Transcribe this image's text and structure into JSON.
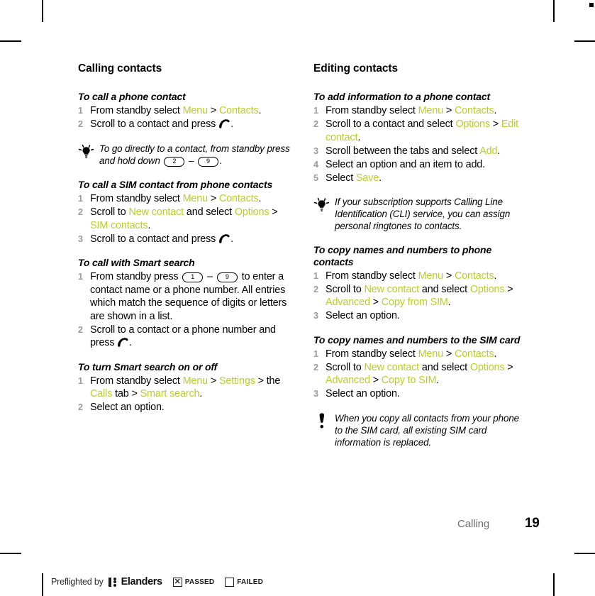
{
  "accent_color": "#b8cf28",
  "left_column": {
    "section_title": "Calling contacts",
    "blocks": [
      {
        "type": "procedure",
        "title": "To call a phone contact",
        "steps": [
          "From standby select <span class=\"g\">Menu</span> &gt; <span class=\"g\">Contacts</span>.",
          "Scroll to a contact and press <span class=\"callicon\" data-name=\"call-key-icon\"></span>."
        ]
      },
      {
        "type": "tip",
        "icon": "lightbulb-icon",
        "text": "To go directly to a contact, from standby press and hold down <span class=\"key\">2</span> &#8211; <span class=\"key\">9</span>."
      },
      {
        "type": "procedure",
        "title": "To call a SIM contact from phone contacts",
        "steps": [
          "From standby select <span class=\"g\">Menu</span> &gt; <span class=\"g\">Contacts</span>.",
          "Scroll to <span class=\"g\">New contact</span> and select <span class=\"g\">Options</span> &gt; <span class=\"g\">SIM contacts</span>.",
          "Scroll to a contact and press <span class=\"callicon\" data-name=\"call-key-icon\"></span>."
        ]
      },
      {
        "type": "procedure",
        "title": "To call with Smart search",
        "steps": [
          "From standby press <span class=\"key\">1</span> &#8211; <span class=\"key\">9</span> to enter a contact name or a phone number. All entries which match the sequence of digits or letters are shown in a list.",
          "Scroll to a contact or a phone number and press <span class=\"callicon\" data-name=\"call-key-icon\"></span>."
        ]
      },
      {
        "type": "procedure",
        "title": "To turn Smart search on or off",
        "steps": [
          "From standby select <span class=\"g\">Menu</span> &gt; <span class=\"g\">Settings</span> &gt; the <span class=\"g\">Calls</span> tab &gt; <span class=\"g\">Smart search</span>.",
          "Select an option."
        ]
      }
    ]
  },
  "right_column": {
    "section_title": "Editing contacts",
    "blocks": [
      {
        "type": "procedure",
        "title": "To add information to a phone contact",
        "steps": [
          "From standby select <span class=\"g\">Menu</span> &gt; <span class=\"g\">Contacts</span>.",
          "Scroll to a contact and select <span class=\"g\">Options</span> &gt; <span class=\"g\">Edit contact</span>.",
          "Scroll between the tabs and select <span class=\"g\">Add</span>.",
          "Select an option and an item to add.",
          "Select <span class=\"g\">Save</span>."
        ]
      },
      {
        "type": "tip",
        "icon": "lightbulb-icon",
        "text": "If your subscription supports Calling Line Identification (CLI) service, you can assign personal ringtones to contacts."
      },
      {
        "type": "procedure",
        "title": "To copy names and numbers to phone contacts",
        "steps": [
          "From standby select <span class=\"g\">Menu</span> &gt; <span class=\"g\">Contacts</span>.",
          "Scroll to <span class=\"g\">New contact</span> and select <span class=\"g\">Options</span> &gt; <span class=\"g\">Advanced</span> &gt; <span class=\"g\">Copy from SIM</span>.",
          "Select an option."
        ]
      },
      {
        "type": "procedure",
        "title": "To copy names and numbers to the SIM card",
        "steps": [
          "From standby select <span class=\"g\">Menu</span> &gt; <span class=\"g\">Contacts</span>.",
          "Scroll to <span class=\"g\">New contact</span> and select <span class=\"g\">Options</span> &gt; <span class=\"g\">Advanced</span> &gt; <span class=\"g\">Copy to SIM</span>.",
          "Select an option."
        ]
      },
      {
        "type": "warning",
        "icon": "exclamation-icon",
        "text": "When you copy all contacts from your phone to the SIM card, all existing SIM card information is replaced."
      }
    ]
  },
  "footer": {
    "chapter": "Calling",
    "page_number": "19"
  },
  "preflight": {
    "label": "Preflighted by",
    "brand": "Elanders",
    "passed_mark": "☒",
    "passed_label": "PASSED",
    "failed_mark": "",
    "failed_label": "FAILED"
  }
}
